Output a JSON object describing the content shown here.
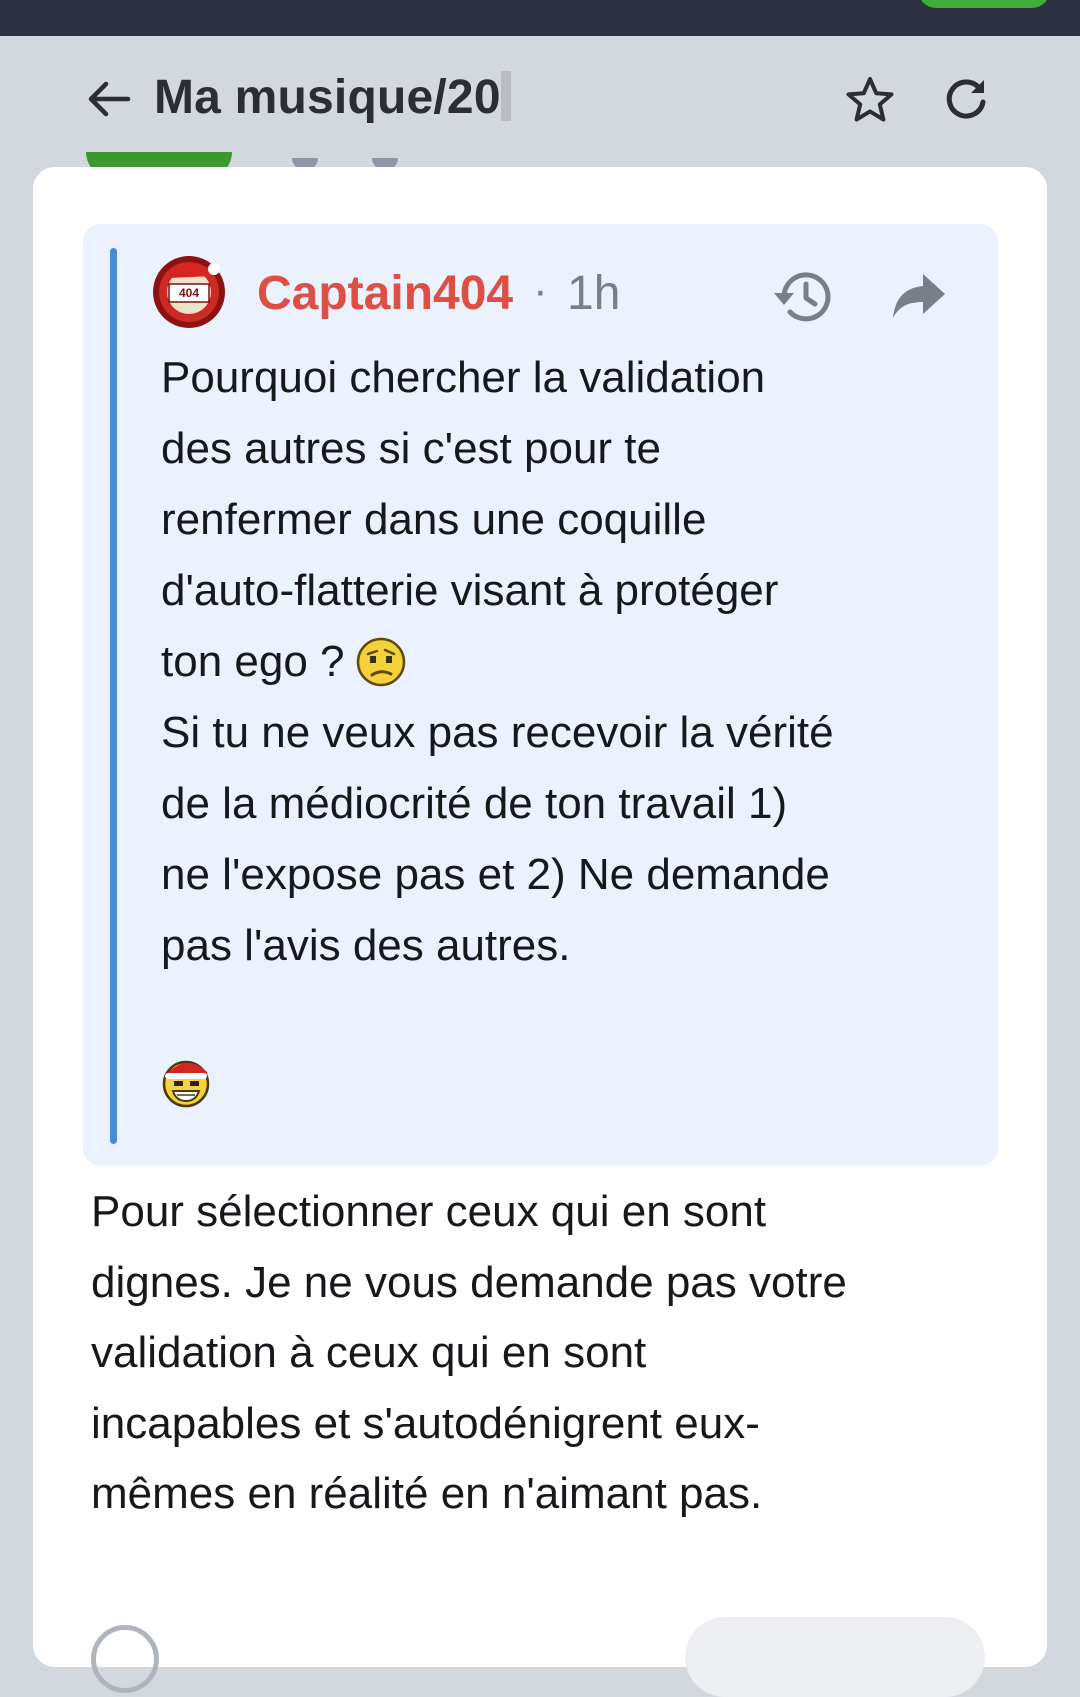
{
  "header": {
    "title": "Ma musique/20",
    "back_icon": "arrow-left-icon",
    "star_icon": "star-outline-icon",
    "refresh_icon": "refresh-icon"
  },
  "quote": {
    "author": "Captain404",
    "separator": "·",
    "time": "1h",
    "avatar_badge": "ERROR 404",
    "lines": [
      "Pourquoi chercher la validation",
      "des autres si c'est pour te",
      "renfermer dans une coquille",
      "d'auto-flatterie visant à protéger",
      "ton ego ?",
      "Si tu ne veux pas recevoir la vérité",
      "de la médiocrité de ton travail 1)",
      "ne l'expose pas et 2) Ne demande",
      "pas l'avis des autres."
    ]
  },
  "reply": {
    "lines": [
      "Pour sélectionner ceux qui en sont",
      "dignes. Je ne vous demande pas votre",
      "validation à ceux qui en sont",
      "incapables et s'autodénigrent eux-",
      "mêmes en réalité en n'aimant pas."
    ]
  },
  "colors": {
    "page_bg": "#d3d7de",
    "status_bar": "#2c3142",
    "card_bg": "#ffffff",
    "quote_bg": "#ecf1fe",
    "quote_bar": "#4a8bd8",
    "author": "#dd4f44",
    "muted": "#7a7e87"
  }
}
